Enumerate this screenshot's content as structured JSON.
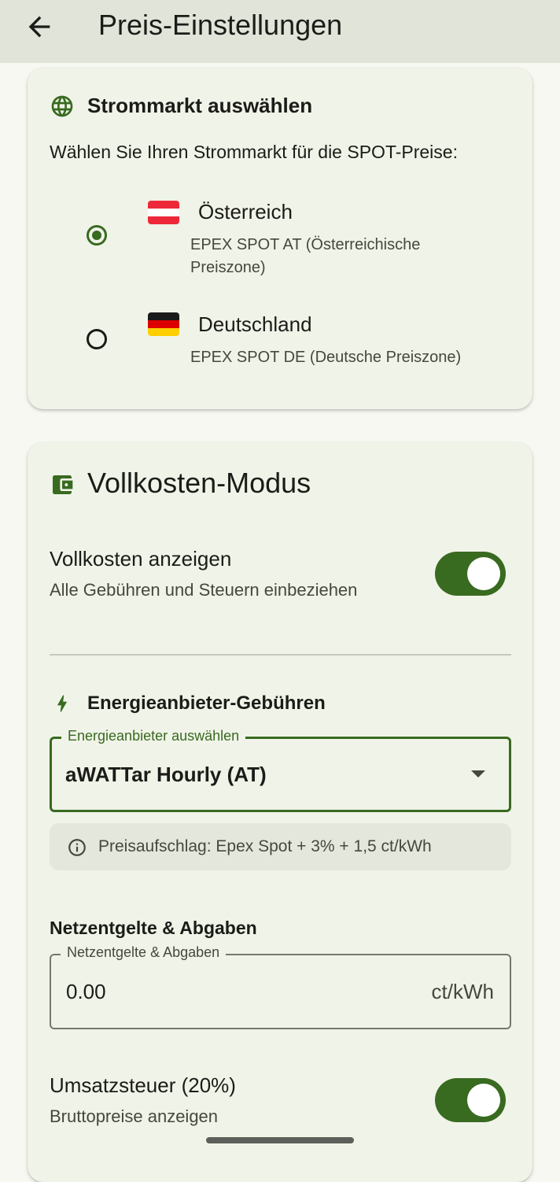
{
  "app_bar": {
    "title": "Preis-Einstellungen",
    "back_icon": "arrow-back-icon"
  },
  "market": {
    "title": "Strommarkt auswählen",
    "icon": "globe-icon",
    "subtitle": "Wählen Sie Ihren Strommarkt für die SPOT-Preise:",
    "options": [
      {
        "label": "Österreich",
        "description": "EPEX SPOT AT (Österreichische Preiszone)",
        "selected": true,
        "flag": "austria-flag"
      },
      {
        "label": "Deutschland",
        "description": "EPEX SPOT DE (Deutsche Preiszone)",
        "selected": false,
        "flag": "germany-flag"
      }
    ]
  },
  "full_cost": {
    "title": "Vollkosten-Modus",
    "icon": "wallet-icon",
    "show_full_cost": {
      "label": "Vollkosten anzeigen",
      "sublabel": "Alle Gebühren und Steuern einbeziehen",
      "enabled": true
    },
    "provider_section": {
      "title": "Energieanbieter-Gebühren",
      "icon": "bolt-icon",
      "select_label": "Energieanbieter auswählen",
      "selected_value": "aWATTar Hourly (AT)",
      "info_text": "Preisaufschlag: Epex Spot + 3% + 1,5 ct/kWh"
    },
    "grid_fees": {
      "heading": "Netzentgelte & Abgaben",
      "field_label": "Netzentgelte & Abgaben",
      "value": "0.00",
      "suffix": "ct/kWh"
    },
    "vat": {
      "label": "Umsatzsteuer (20%)",
      "sublabel": "Bruttopreise anzeigen",
      "enabled": true
    }
  },
  "colors": {
    "primary": "#386a20",
    "app_bar_bg": "#e1e4d9",
    "card_bg": "#f0f3e8",
    "page_bg": "#f7f8f1"
  }
}
